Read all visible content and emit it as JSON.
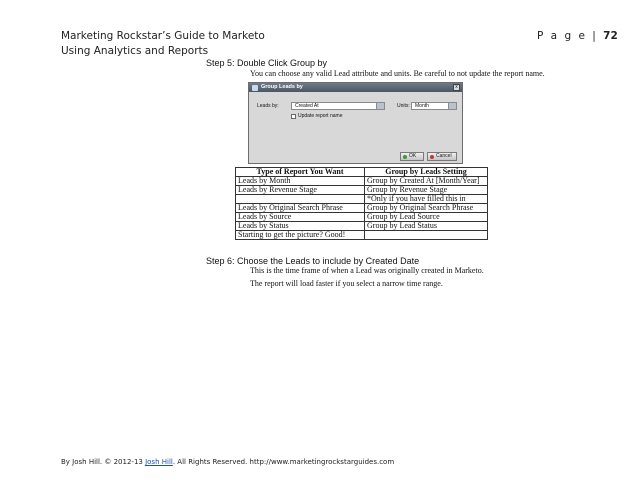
{
  "header": {
    "book_title": "Marketing Rockstar’s Guide to Marketo",
    "chapter": "Using Analytics and Reports",
    "page_prefix": "P a g e",
    "page_sep": "|",
    "page_number": "72"
  },
  "step5": {
    "label": "Step 5:",
    "title": "Double Click Group by",
    "description": "You can choose any valid Lead attribute and units. Be careful to not update the report name."
  },
  "dialog": {
    "title": "Group Leads by",
    "leads_by_label": "Leads by:",
    "leads_by_value": "Created At",
    "units_label": "Units:",
    "units_value": "Month",
    "update_checkbox_label": "Update report name",
    "update_checked": false,
    "ok_label": "OK",
    "cancel_label": "Cancel",
    "close_glyph": "x"
  },
  "table": {
    "headers": [
      "Type of Report You Want",
      "Group by Leads Setting"
    ],
    "rows": [
      [
        "Leads by Month",
        "Group by Created At [Month/Year]"
      ],
      [
        "Leads by Revenue Stage",
        "Group by Revenue Stage"
      ],
      [
        "",
        "*Only if you have filled this in"
      ],
      [
        "Leads by Original Search Phrase",
        "Group by Original Search Phrase"
      ],
      [
        "Leads by Source",
        "Group by Lead Source"
      ],
      [
        "Leads by Status",
        "Group by Lead Status"
      ]
    ],
    "note": "Starting to get the picture? Good!"
  },
  "step6": {
    "label": "Step 6:",
    "title": "Choose the Leads to include by Created Date",
    "line1": "This is the time frame of when a Lead was originally created in Marketo.",
    "line2": "The report will load faster if you select a narrow time range."
  },
  "footer": {
    "prefix": "By Josh Hill. © 2012-13 ",
    "link_text": "Josh Hill",
    "suffix": ". All Rights Reserved. http://www.marketingrockstarguides.com"
  },
  "colors": {
    "link": "#1a4fb3",
    "ok_icon": "#3a9a3a",
    "cancel_icon": "#c43a2a"
  }
}
